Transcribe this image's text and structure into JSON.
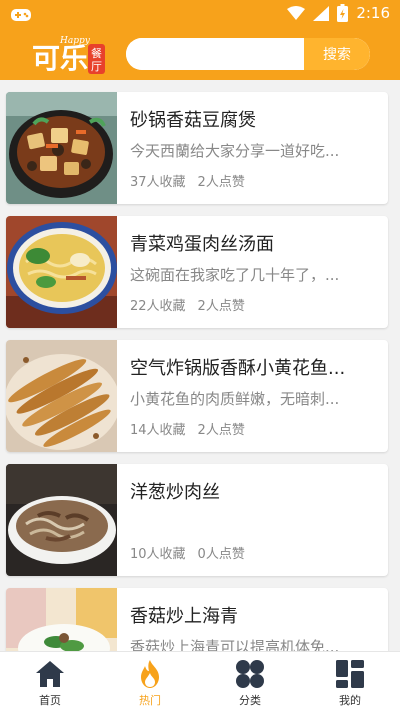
{
  "status_bar": {
    "time": "2:16",
    "icons": [
      "game-controller-icon",
      "wifi-icon",
      "signal-icon",
      "battery-icon"
    ]
  },
  "header": {
    "logo": {
      "main_text": "可乐",
      "script_text": "Happy",
      "badge_text": "餐厅"
    },
    "search": {
      "value": "",
      "placeholder": "",
      "button_label": "搜索"
    }
  },
  "recipes": [
    {
      "title": "砂锅香菇豆腐煲",
      "description": "今天西蘭给大家分享一道好吃...",
      "favorites": "37人收藏",
      "likes": "2人点赞"
    },
    {
      "title": "青菜鸡蛋肉丝汤面",
      "description": "这碗面在我家吃了几十年了，...",
      "favorites": "22人收藏",
      "likes": "2人点赞"
    },
    {
      "title": "空气炸锅版香酥小黄花鱼...",
      "description": "小黄花鱼的肉质鲜嫩，无暗刺...",
      "favorites": "14人收藏",
      "likes": "2人点赞"
    },
    {
      "title": "洋葱炒肉丝",
      "description": "",
      "favorites": "10人收藏",
      "likes": "0人点赞"
    },
    {
      "title": "香菇炒上海青",
      "description": "香菇炒上海青可以提高机体免...",
      "favorites": "",
      "likes": ""
    }
  ],
  "bottom_nav": {
    "active": "热门",
    "items": [
      {
        "label": "首页",
        "icon": "home-icon"
      },
      {
        "label": "热门",
        "icon": "flame-icon"
      },
      {
        "label": "分类",
        "icon": "category-icon"
      },
      {
        "label": "我的",
        "icon": "profile-grid-icon"
      }
    ]
  },
  "colors": {
    "brand_orange": "#f7a21b",
    "search_button": "#ffb42e",
    "nav_icon_dark": "#2f3a4a",
    "text_gray": "#888888"
  }
}
